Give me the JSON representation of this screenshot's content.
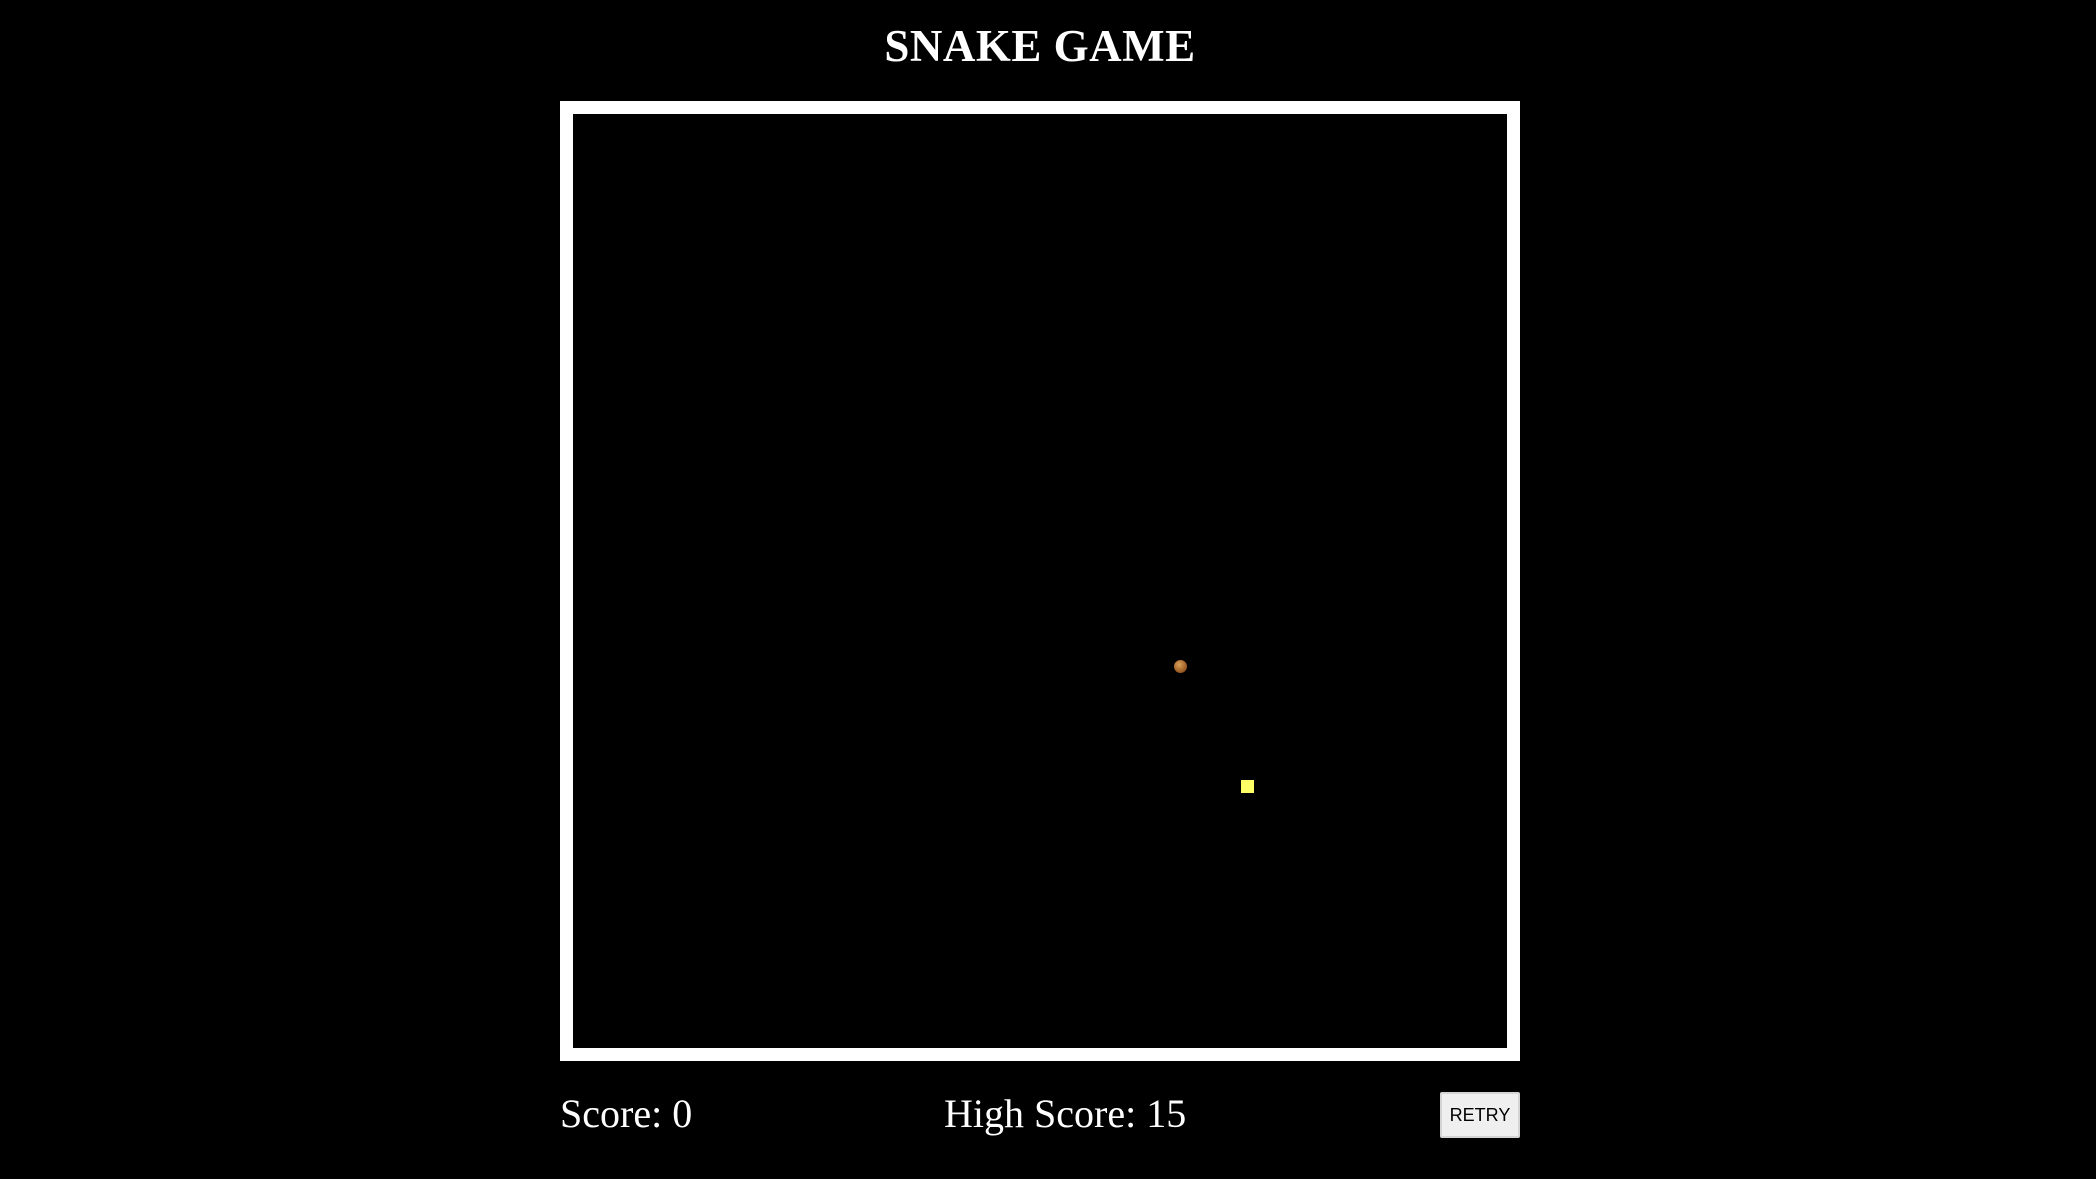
{
  "header": {
    "title": "SNAKE GAME"
  },
  "game": {
    "food_color": "#a5652a",
    "snake_color": "#ffff66",
    "board_border_color": "#ffffff",
    "background_color": "#000000"
  },
  "footer": {
    "score_label": "Score: 0",
    "high_score_label": "High Score: 15",
    "retry_label": "RETRY"
  }
}
